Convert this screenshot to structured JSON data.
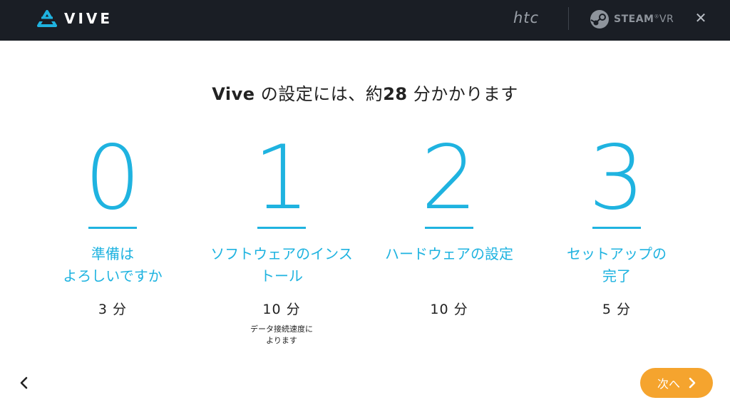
{
  "header": {
    "brand": "VIVE",
    "htc": "htc",
    "steam_bold": "STEAM",
    "steam_light": "VR",
    "close_label": "✕"
  },
  "headline": {
    "pre": "Vive",
    "mid": " の設定には、約",
    "minutes": "28",
    "post": " 分かかります"
  },
  "steps": [
    {
      "number": "0",
      "label_line1": "準備は",
      "label_line2": "よろしいですか",
      "duration": "3 分",
      "note_line1": "",
      "note_line2": ""
    },
    {
      "number": "1",
      "label_line1": "ソフトウェアのインス",
      "label_line2": "トール",
      "duration": "10 分",
      "note_line1": "データ接続速度に",
      "note_line2": "よります"
    },
    {
      "number": "2",
      "label_line1": "ハードウェアの設定",
      "label_line2": "",
      "duration": "10 分",
      "note_line1": "",
      "note_line2": ""
    },
    {
      "number": "3",
      "label_line1": "セットアップの",
      "label_line2": "完了",
      "duration": "5 分",
      "note_line1": "",
      "note_line2": ""
    }
  ],
  "footer": {
    "next_label": "次へ"
  },
  "colors": {
    "accent": "#1fb3e0",
    "next_button": "#f5a42e",
    "header_bg": "#1a1e25"
  }
}
